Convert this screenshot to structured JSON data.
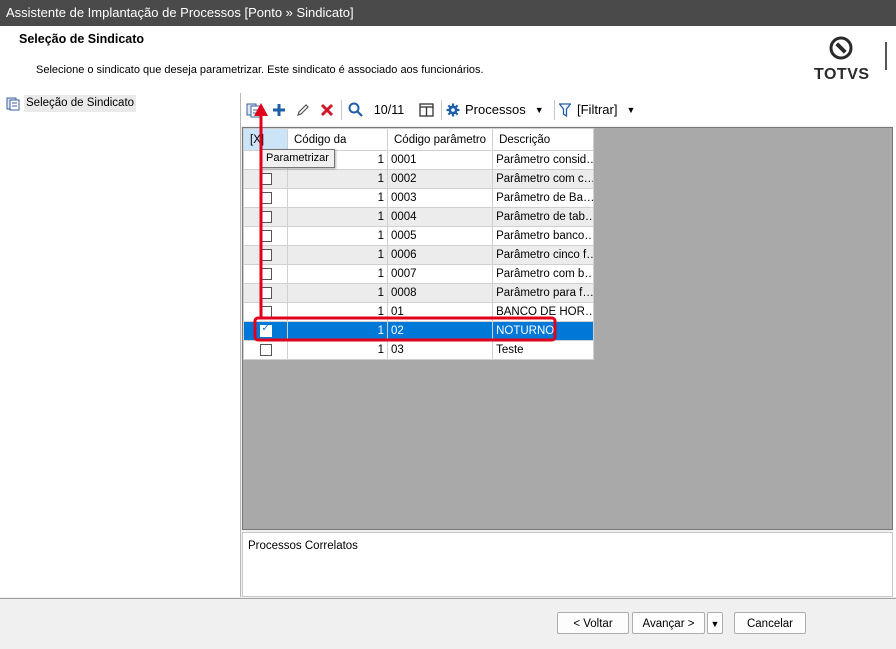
{
  "window": {
    "title": "Assistente de Implantação de Processos [Ponto » Sindicato]"
  },
  "header": {
    "title": "Seleção de Sindicato",
    "subtitle": "Selecione o sindicato que deseja parametrizar. Este sindicato é associado aos funcionários.",
    "logo": "TOTVS"
  },
  "tree": {
    "items": [
      {
        "label": "Seleção de Sindicato",
        "icon": "wizard-step-icon"
      }
    ]
  },
  "toolbar": {
    "record_counter": "10/11",
    "processes_label": "Processos",
    "filter_label": "[Filtrar]",
    "tooltip": "Parametrizar",
    "icons": [
      "parametrize-icon",
      "add-icon",
      "edit-icon",
      "delete-icon",
      "search-icon",
      "columns-icon",
      "gear-icon",
      "filter-icon"
    ]
  },
  "grid": {
    "columns": [
      "[X]",
      "Código da",
      "Código parâmetro",
      "Descrição"
    ],
    "rows": [
      {
        "checked": false,
        "codigo": "1",
        "parametro": "0001",
        "descricao": "Parâmetro consid…"
      },
      {
        "checked": false,
        "codigo": "1",
        "parametro": "0002",
        "descricao": "Parâmetro com c…"
      },
      {
        "checked": false,
        "codigo": "1",
        "parametro": "0003",
        "descricao": "Parâmetro de Ba…"
      },
      {
        "checked": false,
        "codigo": "1",
        "parametro": "0004",
        "descricao": "Parâmetro de tab…"
      },
      {
        "checked": false,
        "codigo": "1",
        "parametro": "0005",
        "descricao": "Parâmetro banco…"
      },
      {
        "checked": false,
        "codigo": "1",
        "parametro": "0006",
        "descricao": "Parâmetro cinco f…"
      },
      {
        "checked": false,
        "codigo": "1",
        "parametro": "0007",
        "descricao": "Parâmetro com b…"
      },
      {
        "checked": false,
        "codigo": "1",
        "parametro": "0008",
        "descricao": "Parâmetro para f…"
      },
      {
        "checked": false,
        "codigo": "1",
        "parametro": "01",
        "descricao": "BANCO DE HOR…"
      },
      {
        "checked": true,
        "selected": true,
        "codigo": "1",
        "parametro": "02",
        "descricao": "NOTURNO"
      },
      {
        "checked": false,
        "codigo": "1",
        "parametro": "03",
        "descricao": "Teste"
      }
    ]
  },
  "related": {
    "label": "Processos Correlatos"
  },
  "footer": {
    "back": "< Voltar",
    "next": "Avançar >",
    "cancel": "Cancelar"
  },
  "colors": {
    "selection": "#0078d7",
    "annotation": "#e0001b",
    "titlebar": "#4a4a4a"
  }
}
